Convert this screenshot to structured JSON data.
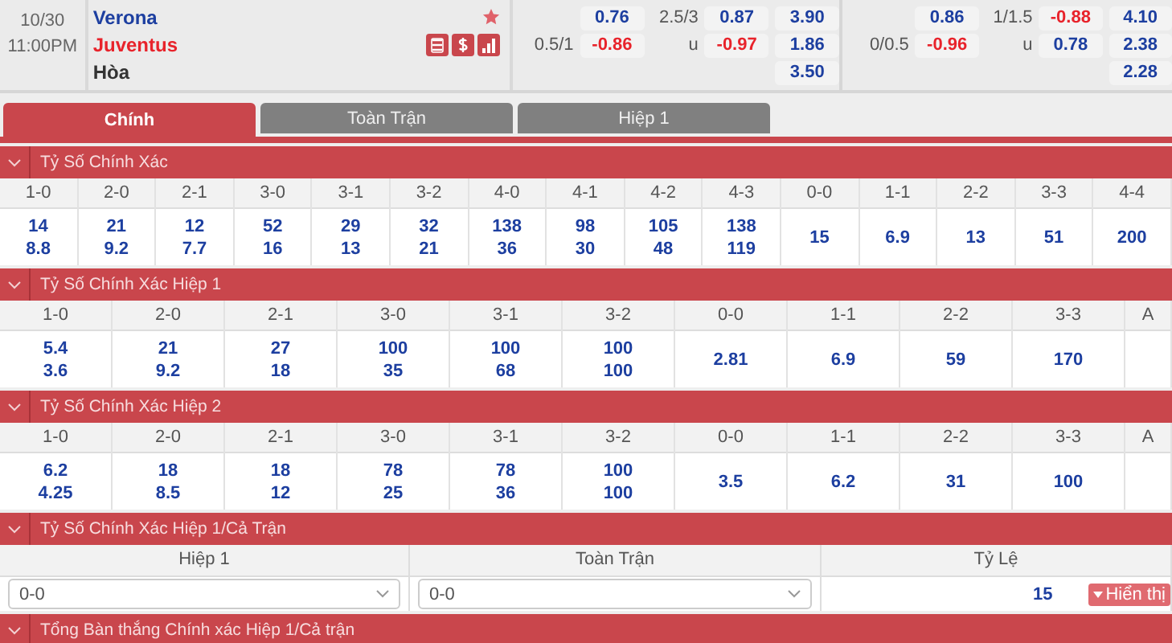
{
  "match": {
    "date": "10/30",
    "time": "11:00PM",
    "home": "Verona",
    "away": "Juventus",
    "draw": "Hòa",
    "favorite": true
  },
  "markets": [
    {
      "rows": [
        {
          "ah_odds": {
            "text": "0.76",
            "negative": false
          },
          "ou_line": "2.5/3",
          "ou_odds": {
            "text": "0.87",
            "negative": false
          },
          "x12": "3.90"
        },
        {
          "ah_line": "0.5/1",
          "ah_odds": {
            "text": "-0.86",
            "negative": true
          },
          "ou_line": "u",
          "ou_odds": {
            "text": "-0.97",
            "negative": true
          },
          "x12": "1.86"
        },
        {
          "x12": "3.50"
        }
      ]
    },
    {
      "rows": [
        {
          "ah_odds": {
            "text": "0.86",
            "negative": false
          },
          "ou_line": "1/1.5",
          "ou_odds": {
            "text": "-0.88",
            "negative": true
          },
          "x12": "4.10"
        },
        {
          "ah_line": "0/0.5",
          "ah_odds": {
            "text": "-0.96",
            "negative": true
          },
          "ou_line": "u",
          "ou_odds": {
            "text": "0.78",
            "negative": false
          },
          "x12": "2.38"
        },
        {
          "x12": "2.28"
        }
      ]
    }
  ],
  "tabs": [
    {
      "label": "Chính",
      "selected": true
    },
    {
      "label": "Toàn Trận",
      "selected": false
    },
    {
      "label": "Hiệp 1",
      "selected": false
    }
  ],
  "sections": [
    {
      "kind": "score_grid",
      "title": "Tỷ Số Chính Xác",
      "columns": [
        {
          "label": "1-0",
          "values": [
            "14",
            "8.8"
          ]
        },
        {
          "label": "2-0",
          "values": [
            "21",
            "9.2"
          ]
        },
        {
          "label": "2-1",
          "values": [
            "12",
            "7.7"
          ]
        },
        {
          "label": "3-0",
          "values": [
            "52",
            "16"
          ]
        },
        {
          "label": "3-1",
          "values": [
            "29",
            "13"
          ]
        },
        {
          "label": "3-2",
          "values": [
            "32",
            "21"
          ]
        },
        {
          "label": "4-0",
          "values": [
            "138",
            "36"
          ]
        },
        {
          "label": "4-1",
          "values": [
            "98",
            "30"
          ]
        },
        {
          "label": "4-2",
          "values": [
            "105",
            "48"
          ]
        },
        {
          "label": "4-3",
          "values": [
            "138",
            "119"
          ]
        },
        {
          "label": "0-0",
          "values": [
            "15"
          ]
        },
        {
          "label": "1-1",
          "values": [
            "6.9"
          ]
        },
        {
          "label": "2-2",
          "values": [
            "13"
          ]
        },
        {
          "label": "3-3",
          "values": [
            "51"
          ]
        },
        {
          "label": "4-4",
          "values": [
            "200"
          ]
        }
      ]
    },
    {
      "kind": "score_grid",
      "title": "Tỷ Số Chính Xác Hiệp 1",
      "columns": [
        {
          "label": "1-0",
          "values": [
            "5.4",
            "3.6"
          ]
        },
        {
          "label": "2-0",
          "values": [
            "21",
            "9.2"
          ]
        },
        {
          "label": "2-1",
          "values": [
            "27",
            "18"
          ]
        },
        {
          "label": "3-0",
          "values": [
            "100",
            "35"
          ]
        },
        {
          "label": "3-1",
          "values": [
            "100",
            "68"
          ]
        },
        {
          "label": "3-2",
          "values": [
            "100",
            "100"
          ]
        },
        {
          "label": "0-0",
          "values": [
            "2.81"
          ]
        },
        {
          "label": "1-1",
          "values": [
            "6.9"
          ]
        },
        {
          "label": "2-2",
          "values": [
            "59"
          ]
        },
        {
          "label": "3-3",
          "values": [
            "170"
          ]
        },
        {
          "label": "A"
        }
      ]
    },
    {
      "kind": "score_grid",
      "title": "Tỷ Số Chính Xác Hiệp 2",
      "columns": [
        {
          "label": "1-0",
          "values": [
            "6.2",
            "4.25"
          ]
        },
        {
          "label": "2-0",
          "values": [
            "18",
            "8.5"
          ]
        },
        {
          "label": "2-1",
          "values": [
            "18",
            "12"
          ]
        },
        {
          "label": "3-0",
          "values": [
            "78",
            "25"
          ]
        },
        {
          "label": "3-1",
          "values": [
            "78",
            "36"
          ]
        },
        {
          "label": "3-2",
          "values": [
            "100",
            "100"
          ]
        },
        {
          "label": "0-0",
          "values": [
            "3.5"
          ]
        },
        {
          "label": "1-1",
          "values": [
            "6.2"
          ]
        },
        {
          "label": "2-2",
          "values": [
            "31"
          ]
        },
        {
          "label": "3-3",
          "values": [
            "100"
          ]
        },
        {
          "label": "A"
        }
      ]
    },
    {
      "kind": "half_full",
      "title": "Tỷ Số Chính Xác Hiệp 1/Cả Trận",
      "headers": [
        "Hiệp 1",
        "Toàn Trận",
        "Tỷ Lệ"
      ],
      "half_value": "0-0",
      "full_value": "0-0",
      "odds": "15",
      "button": "Hiển thị"
    },
    {
      "kind": "header_only",
      "title": "Tổng Bàn thắng Chính xác Hiệp 1/Cả trận"
    }
  ]
}
